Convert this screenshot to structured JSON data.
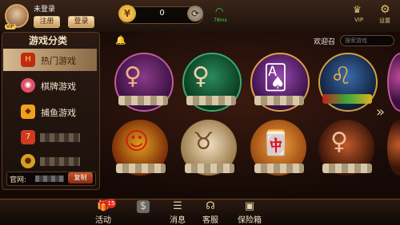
{
  "header": {
    "login_status": "未登录",
    "register_label": "注册",
    "login_label": "登录",
    "avatar_badge": "VIP",
    "coins": "0",
    "ping": "78ms",
    "vip_label": "VIP",
    "settings_label": "设置"
  },
  "sidebar": {
    "title": "游戏分类",
    "items": [
      {
        "label": "热门游戏",
        "icon": "hot-icon",
        "active": true
      },
      {
        "label": "棋牌游戏",
        "icon": "poker-chip-icon"
      },
      {
        "label": "捕鱼游戏",
        "icon": "fish-icon"
      },
      {
        "label": "",
        "icon": "slot-icon"
      },
      {
        "label": "",
        "icon": "gold-icon"
      }
    ],
    "site_label": "官网:",
    "copy_label": "复制"
  },
  "main": {
    "welcome": "欢迎召",
    "search_placeholder": "搜索游戏",
    "games": [
      {
        "icon": "lady-red-icon"
      },
      {
        "icon": "lady-green-icon"
      },
      {
        "icon": "poker-cards-icon"
      },
      {
        "icon": "lion-icon"
      },
      {
        "icon": "fortune-god-icon"
      },
      {
        "icon": "cow-icon"
      },
      {
        "icon": "mahjong-icon"
      },
      {
        "icon": "cowgirl-icon"
      }
    ]
  },
  "bottom_nav": {
    "items": [
      {
        "label": "活动",
        "icon": "gift-icon",
        "badge": "15"
      },
      {
        "label": "",
        "icon": "money-icon"
      },
      {
        "label": "消息",
        "icon": "message-icon"
      },
      {
        "label": "客服",
        "icon": "headset-icon"
      },
      {
        "label": "保险箱",
        "icon": "safe-icon"
      }
    ]
  },
  "colors": {
    "accent_gold": "#e4c07a",
    "ping_green": "#3fd34a",
    "badge_red": "#e02a1a"
  }
}
